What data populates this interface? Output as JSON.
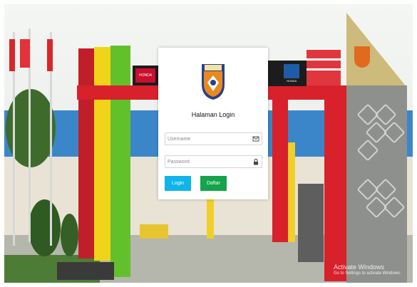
{
  "login": {
    "title": "Halaman Login",
    "username": {
      "placeholder": "Username",
      "value": ""
    },
    "password": {
      "placeholder": "Password",
      "value": ""
    },
    "login_label": "Login",
    "daftar_label": "Daftar"
  },
  "background": {
    "sign_left": "HONDA",
    "sign_right": "HONDA"
  },
  "watermark": {
    "title": "Activate Windows",
    "subtitle": "Go to Settings to activate Windows."
  },
  "colors": {
    "login_button": "#0fb4e8",
    "daftar_button": "#13a44c",
    "arch_red": "#d8212b"
  }
}
